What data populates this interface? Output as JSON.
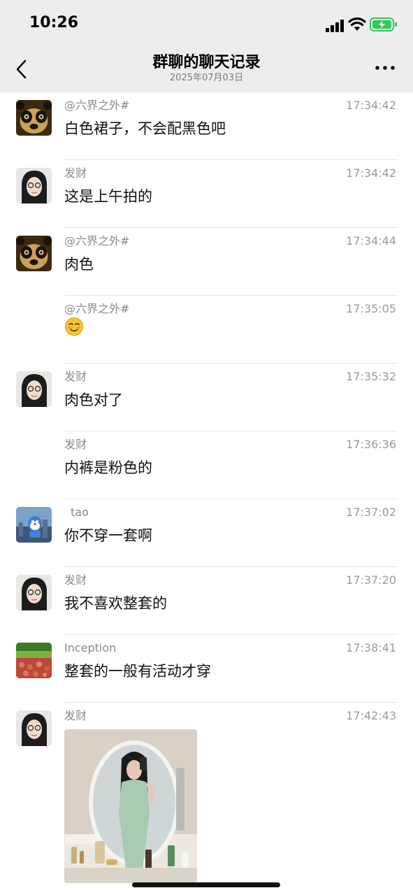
{
  "status": {
    "time": "10:26"
  },
  "header": {
    "title": "群聊的聊天记录",
    "subtitle": "2025年07月03日"
  },
  "messages": [
    {
      "sender": "@六界之外#",
      "time": "17:34:42",
      "text": "白色裙子，不会配黑色吧",
      "avatar": "panda-avatar"
    },
    {
      "sender": "发财",
      "time": "17:34:42",
      "text": "这是上午拍的",
      "avatar": "girl-avatar"
    },
    {
      "sender": "@六界之外#",
      "time": "17:34:44",
      "text": "肉色",
      "avatar": "panda-avatar"
    },
    {
      "sender": "@六界之外#",
      "time": "17:35:05",
      "text": "",
      "avatar": "none",
      "emoji": "smile-emoji"
    },
    {
      "sender": "发财",
      "time": "17:35:32",
      "text": "肉色对了",
      "avatar": "girl-avatar"
    },
    {
      "sender": "发财",
      "time": "17:36:36",
      "text": "内裤是粉色的",
      "avatar": "none"
    },
    {
      "sender": "tao",
      "time": "17:37:02",
      "text": "你不穿一套啊",
      "avatar": "robot-avatar"
    },
    {
      "sender": "发财",
      "time": "17:37:20",
      "text": "我不喜欢整套的",
      "avatar": "girl-avatar"
    },
    {
      "sender": "Inception",
      "time": "17:38:41",
      "text": "整套的一般有活动才穿",
      "avatar": "landscape-avatar"
    },
    {
      "sender": "发财",
      "time": "17:42:43",
      "text": "",
      "avatar": "girl-avatar",
      "image": "mirror-selfie-photo"
    }
  ],
  "colors": {
    "header_bg": "#ededed",
    "battery": "#34c759"
  }
}
